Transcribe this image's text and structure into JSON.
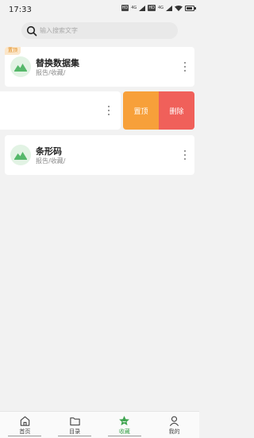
{
  "status_bar": {
    "time": "17:33",
    "badges": [
      "HD",
      "HD"
    ],
    "signal_labels": [
      "4G",
      "4G"
    ]
  },
  "search": {
    "placeholder": "输入搜索文字"
  },
  "items": [
    {
      "pin_badge": "置顶",
      "title": "替换数据集",
      "subtitle": "报告/收藏/"
    },
    {
      "pin_badge": "",
      "title": "",
      "subtitle": ""
    },
    {
      "pin_badge": "",
      "title": "条形码",
      "subtitle": "报告/收藏/"
    }
  ],
  "swipe_actions": {
    "pin_label": "置顶",
    "delete_label": "删除",
    "pin_color": "#f7a03a",
    "delete_color": "#f0605a"
  },
  "tabs": [
    {
      "label": "首页",
      "icon": "home-icon",
      "active": false
    },
    {
      "label": "目录",
      "icon": "folder-icon",
      "active": false
    },
    {
      "label": "收藏",
      "icon": "star-icon",
      "active": true
    },
    {
      "label": "我的",
      "icon": "user-icon",
      "active": false
    }
  ],
  "colors": {
    "accent": "#3ea44f",
    "thumb_bg": "#e2f3e4",
    "background": "#f2f2f2"
  }
}
